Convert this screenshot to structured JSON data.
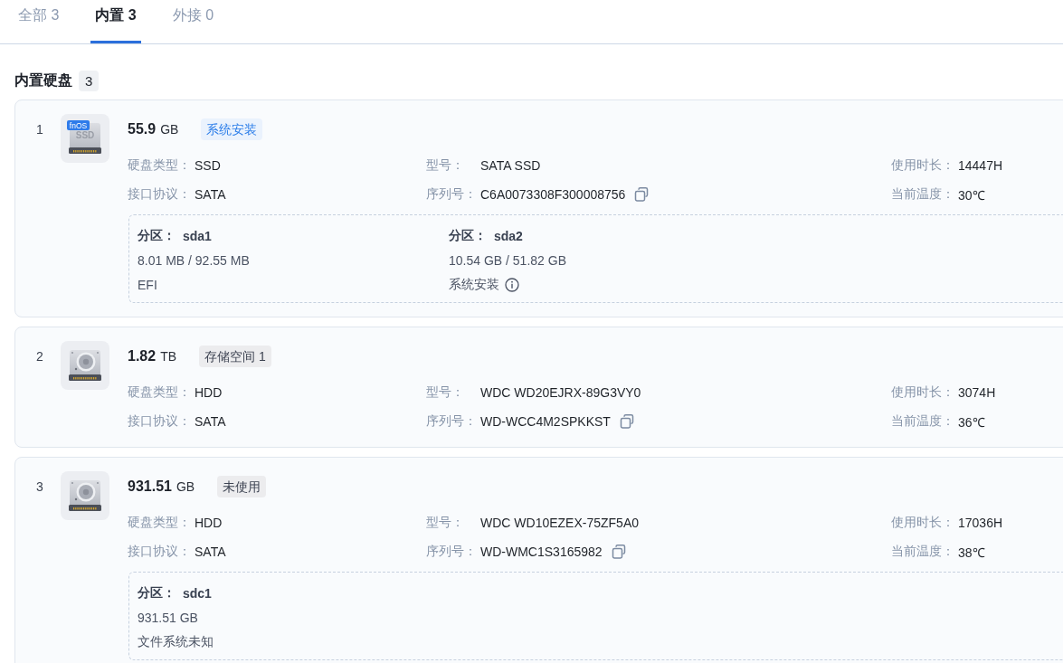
{
  "tabs": [
    {
      "label": "全部 3",
      "selected": false
    },
    {
      "label": "内置 3",
      "selected": true
    },
    {
      "label": "外接 0",
      "selected": false
    }
  ],
  "section": {
    "title": "内置硬盘",
    "count": "3"
  },
  "disks": [
    {
      "index": "1",
      "icon": {
        "kind": "ssd",
        "badge": "fnOS",
        "label": "SSD"
      },
      "size": "55.9",
      "unit": "GB",
      "tag": {
        "text": "系统安装",
        "color": "#2b7de9"
      },
      "fields": [
        {
          "kind": "plain",
          "label": "硬盘类型：",
          "value": "SSD"
        },
        {
          "kind": "plain",
          "label": "型号：",
          "value": "SATA SSD"
        },
        {
          "kind": "plain",
          "label": "使用时长：",
          "value": "14447H"
        },
        {
          "kind": "plain",
          "label": "接口协议：",
          "value": "SATA"
        },
        {
          "kind": "copyable",
          "label": "序列号：",
          "value": "C6A0073308F300008756"
        },
        {
          "kind": "plain",
          "label": "当前温度：",
          "value": "30℃"
        }
      ],
      "partitions": [
        {
          "label": "分区：",
          "name": "sda1",
          "usage": "8.01 MB / 92.55 MB",
          "filesystem": "EFI",
          "info": false
        },
        {
          "label": "分区：",
          "name": "sda2",
          "usage": "10.54 GB / 51.82 GB",
          "filesystem": "系统安装",
          "info": true
        }
      ]
    },
    {
      "index": "2",
      "icon": {
        "kind": "hdd"
      },
      "size": "1.82",
      "unit": "TB",
      "tag": {
        "text": "存储空间 1",
        "color": "#3d4352"
      },
      "fields": [
        {
          "kind": "plain",
          "label": "硬盘类型：",
          "value": "HDD"
        },
        {
          "kind": "plain",
          "label": "型号：",
          "value": "WDC WD20EJRX-89G3VY0"
        },
        {
          "kind": "plain",
          "label": "使用时长：",
          "value": "3074H"
        },
        {
          "kind": "plain",
          "label": "接口协议：",
          "value": "SATA"
        },
        {
          "kind": "copyable",
          "label": "序列号：",
          "value": "WD-WCC4M2SPKKST"
        },
        {
          "kind": "plain",
          "label": "当前温度：",
          "value": "36℃"
        }
      ]
    },
    {
      "index": "3",
      "icon": {
        "kind": "hdd"
      },
      "size": "931.51",
      "unit": "GB",
      "tag": {
        "text": "未使用",
        "color": "#3d4352"
      },
      "fields": [
        {
          "kind": "plain",
          "label": "硬盘类型：",
          "value": "HDD"
        },
        {
          "kind": "plain",
          "label": "型号：",
          "value": "WDC WD10EZEX-75ZF5A0"
        },
        {
          "kind": "plain",
          "label": "使用时长：",
          "value": "17036H"
        },
        {
          "kind": "plain",
          "label": "接口协议：",
          "value": "SATA"
        },
        {
          "kind": "copyable",
          "label": "序列号：",
          "value": "WD-WMC1S3165982"
        },
        {
          "kind": "plain",
          "label": "当前温度：",
          "value": "38℃"
        }
      ],
      "partitions": [
        {
          "label": "分区：",
          "name": "sdc1",
          "usage": "931.51 GB",
          "filesystem": "文件系统未知",
          "info": false
        }
      ]
    }
  ]
}
